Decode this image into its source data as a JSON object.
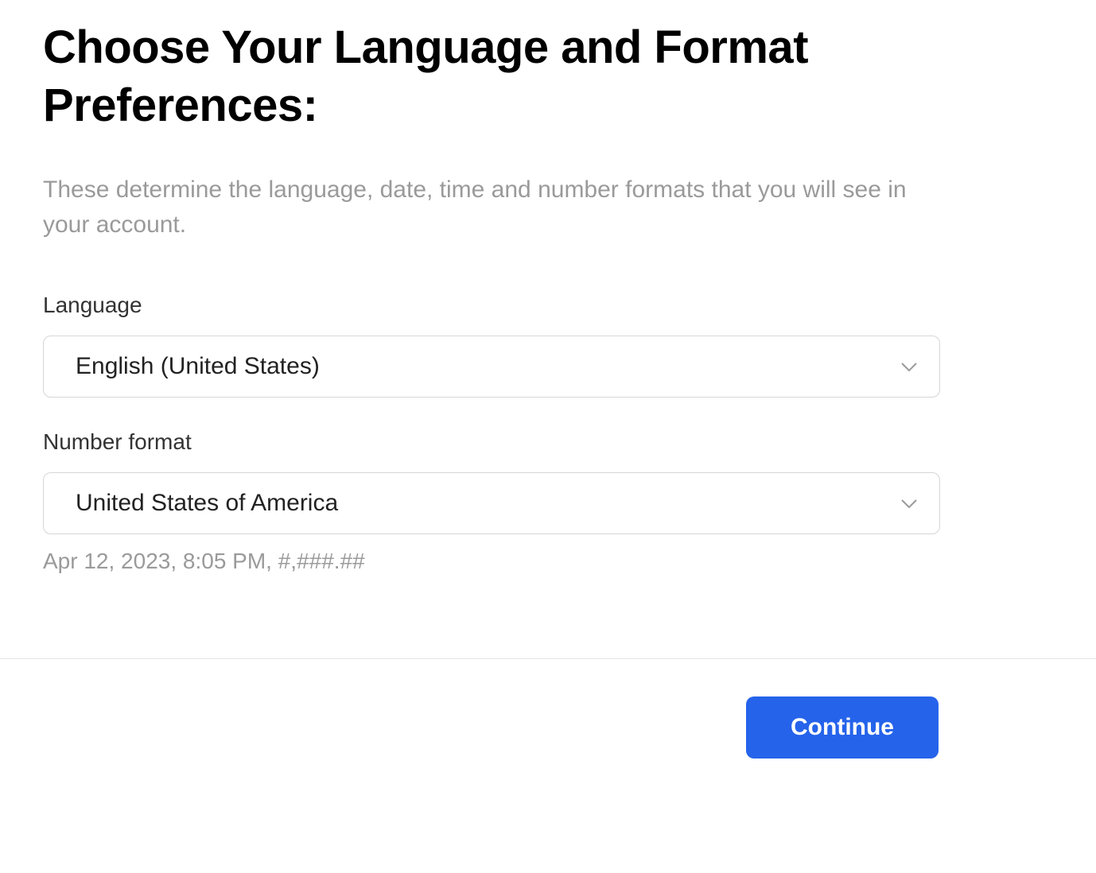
{
  "header": {
    "title": "Choose Your Language and Format Preferences:",
    "subtitle": "These determine the language, date, time and number formats that you will see in your account."
  },
  "fields": {
    "language": {
      "label": "Language",
      "value": "English (United States)"
    },
    "number_format": {
      "label": "Number format",
      "value": "United States of America",
      "example": "Apr 12, 2023, 8:05 PM, #,###.##"
    }
  },
  "actions": {
    "continue_label": "Continue"
  }
}
